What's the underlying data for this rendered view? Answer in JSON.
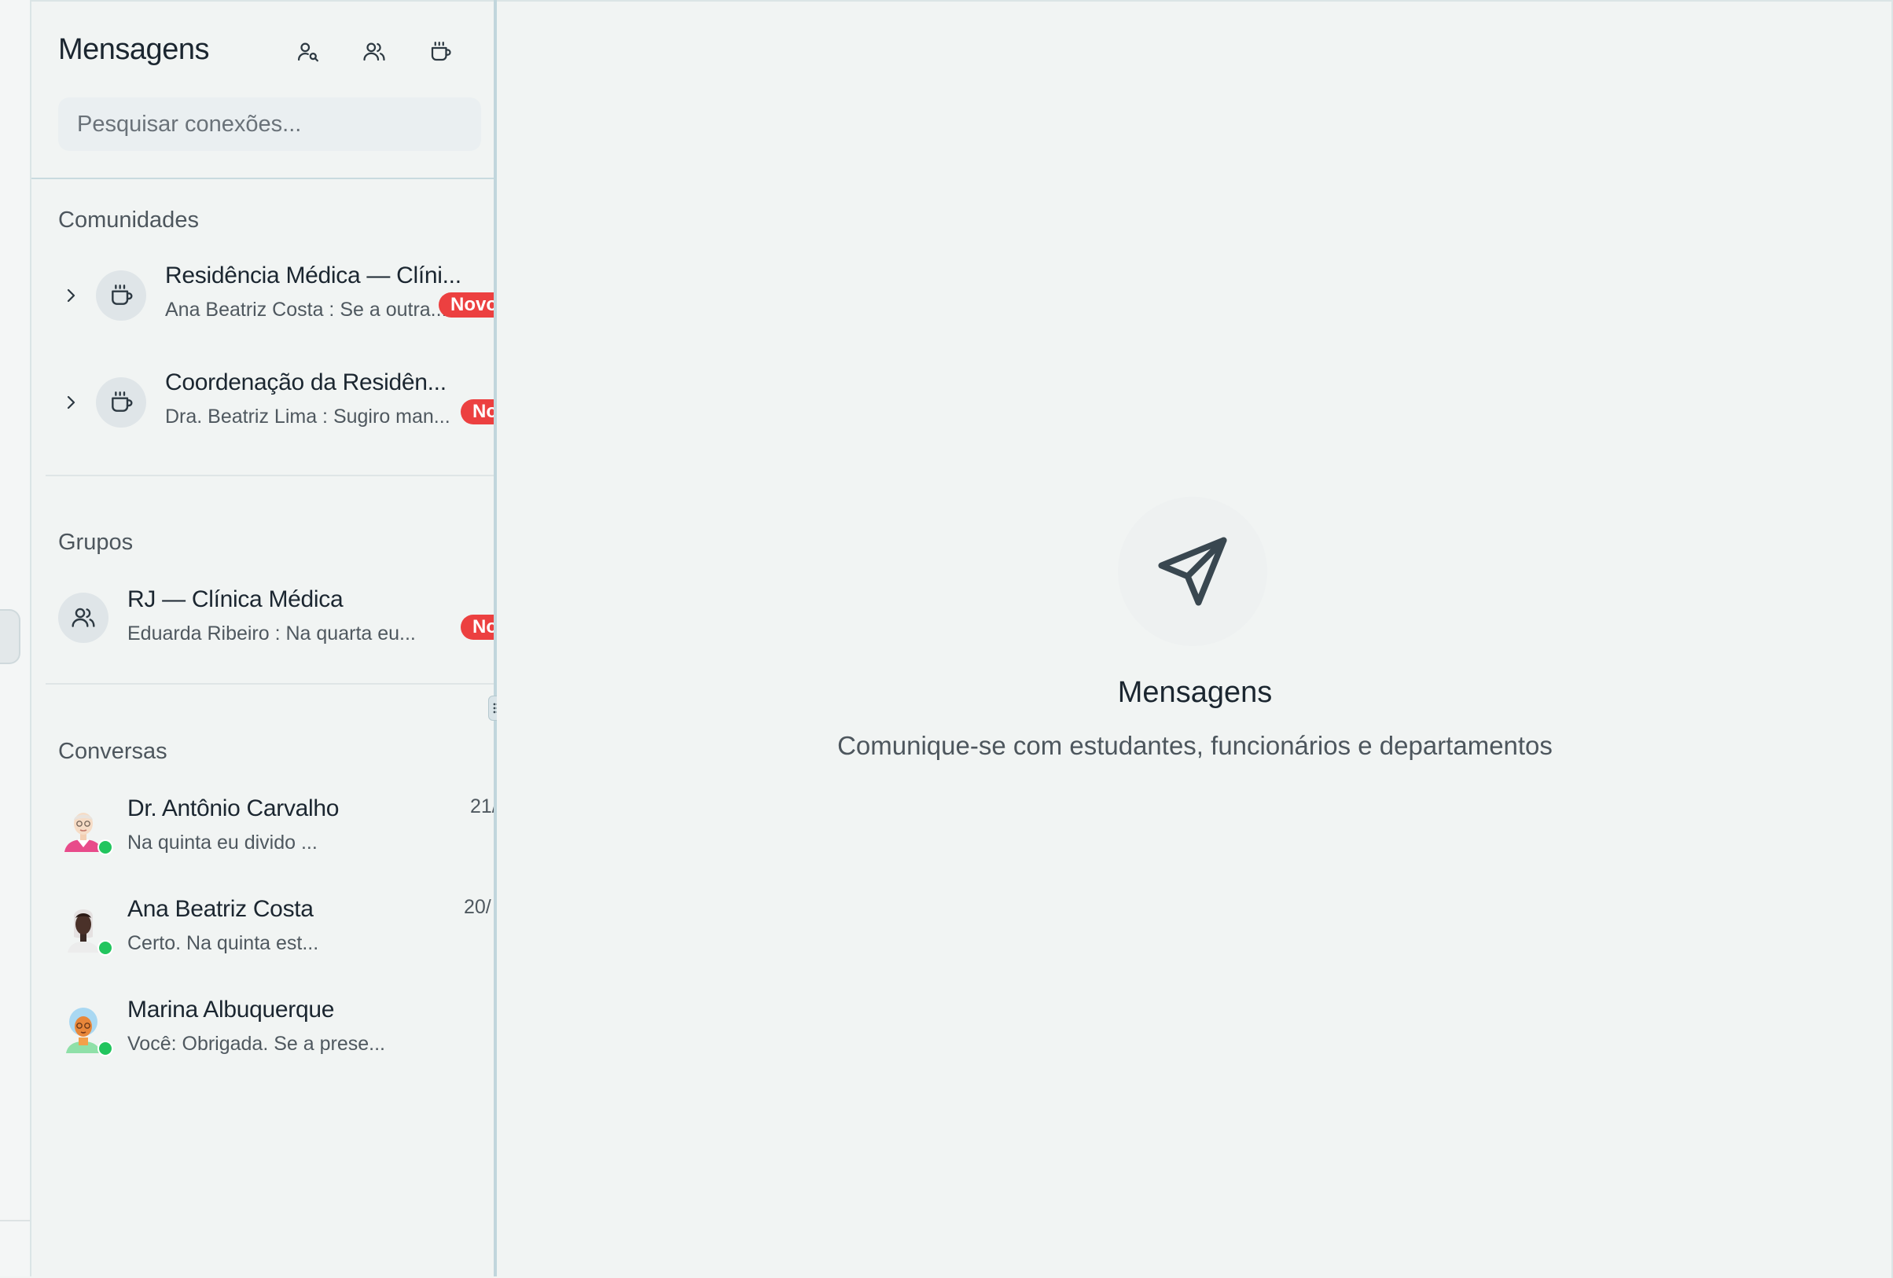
{
  "header": {
    "title": "Mensagens"
  },
  "search": {
    "placeholder": "Pesquisar conexões..."
  },
  "sections": {
    "communities": "Comunidades",
    "groups": "Grupos",
    "conversations": "Conversas"
  },
  "communities": [
    {
      "title": "Residência Médica — Clíni...",
      "preview": "Ana Beatriz Costa : Se a outra...",
      "badge": "Novo"
    },
    {
      "title": "Coordenação da Residên...",
      "preview": "Dra. Beatriz Lima : Sugiro man...",
      "badge": "No"
    }
  ],
  "groups": [
    {
      "title": "RJ — Clínica Médica",
      "preview": "Eduarda Ribeiro : Na quarta eu...",
      "badge": "No"
    }
  ],
  "conversations": [
    {
      "name": "Dr. Antônio Carvalho",
      "preview": "Na quinta eu divido ...",
      "time": "21/"
    },
    {
      "name": "Ana Beatriz Costa",
      "preview": "Certo. Na quinta est...",
      "time": "20/"
    },
    {
      "name": "Marina Albuquerque",
      "preview": "Você: Obrigada. Se a prese...",
      "time": ""
    }
  ],
  "empty_state": {
    "title": "Mensagens",
    "subtitle": "Comunique-se com estudantes, funcionários e departamentos"
  },
  "colors": {
    "badge": "#ec4040",
    "online": "#22c55e",
    "accent_divider": "#c1d6dc",
    "background": "#f1f4f3"
  },
  "icons": {
    "new_contact": "user-search-icon",
    "new_group": "users-icon",
    "community": "coffee-cup-icon",
    "expand": "chevron-right-icon",
    "empty_state": "send-icon",
    "resize": "drag-handle-icon"
  }
}
